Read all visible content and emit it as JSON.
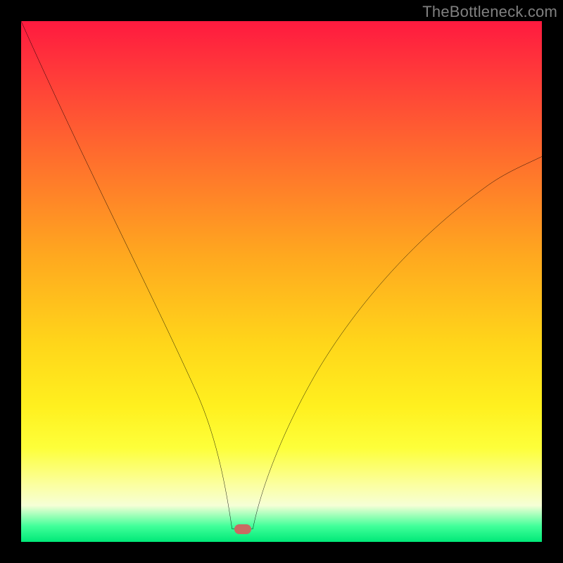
{
  "watermark": "TheBottleneck.com",
  "marker": {
    "x_pct": 42.5,
    "y_pct": 97.5,
    "color": "#c96a62"
  },
  "chart_data": {
    "type": "line",
    "title": "",
    "xlabel": "",
    "ylabel": "",
    "xlim": [
      0,
      100
    ],
    "ylim": [
      0,
      100
    ],
    "grid": false,
    "legend": false,
    "annotations": [
      {
        "text": "TheBottleneck.com",
        "position": "top-right"
      }
    ],
    "series": [
      {
        "name": "left-branch",
        "x": [
          0,
          5,
          10,
          15,
          20,
          25,
          30,
          35,
          38,
          40,
          41,
          42.5
        ],
        "y": [
          100,
          90,
          79,
          68,
          56,
          44,
          31,
          18,
          10,
          5,
          2,
          0
        ]
      },
      {
        "name": "bottom-flat",
        "x": [
          40.5,
          44.5
        ],
        "y": [
          0,
          0
        ]
      },
      {
        "name": "right-branch",
        "x": [
          44.5,
          48,
          52,
          57,
          63,
          70,
          78,
          86,
          93,
          100
        ],
        "y": [
          0,
          8,
          16,
          25,
          35,
          45,
          55,
          63,
          69,
          74
        ]
      }
    ],
    "marker_points": [
      {
        "x": 42.5,
        "y": 2.5,
        "shape": "rounded-rect",
        "color": "#c96a62"
      }
    ],
    "background_gradient": {
      "direction": "vertical",
      "stops": [
        {
          "pct": 0,
          "color": "#ff1a3f"
        },
        {
          "pct": 25,
          "color": "#ff6a2e"
        },
        {
          "pct": 50,
          "color": "#ffc31f"
        },
        {
          "pct": 75,
          "color": "#fff01f"
        },
        {
          "pct": 93,
          "color": "#f6ffd6"
        },
        {
          "pct": 100,
          "color": "#00e878"
        }
      ]
    }
  }
}
